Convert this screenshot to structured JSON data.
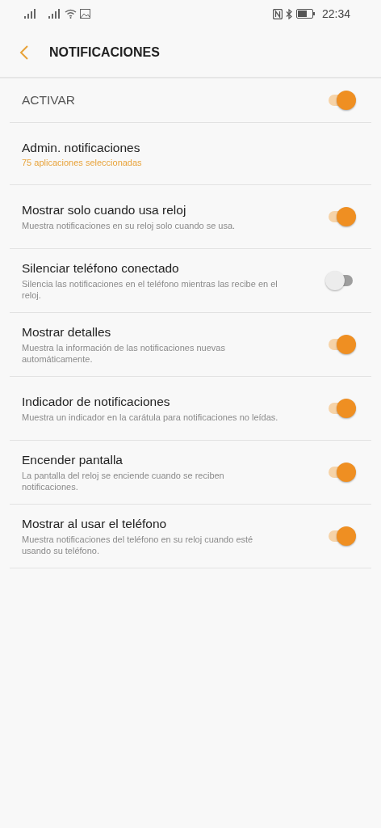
{
  "status_bar": {
    "time": "22:34"
  },
  "header": {
    "title": "NOTIFICACIONES"
  },
  "rows": [
    {
      "kind": "master",
      "title": "ACTIVAR",
      "on": true
    },
    {
      "kind": "link",
      "title": "Admin. notificaciones",
      "subtitle": "75 aplicaciones seleccionadas"
    },
    {
      "kind": "toggle",
      "title": "Mostrar solo cuando usa reloj",
      "description": "Muestra notificaciones en su reloj solo cuando se usa.",
      "on": true
    },
    {
      "kind": "toggle",
      "title": "Silenciar teléfono conectado",
      "description": "Silencia las notificaciones en el teléfono mientras las recibe en el reloj.",
      "on": false
    },
    {
      "kind": "toggle",
      "title": "Mostrar detalles",
      "description": "Muestra la información de las notificaciones nuevas automáticamente.",
      "on": true
    },
    {
      "kind": "toggle",
      "title": "Indicador de notificaciones",
      "description": "Muestra un indicador en la carátula para notificaciones no leídas.",
      "on": true
    },
    {
      "kind": "toggle",
      "title": "Encender pantalla",
      "description": "La pantalla del reloj se enciende cuando se reciben notificaciones.",
      "on": true
    },
    {
      "kind": "toggle",
      "title": "Mostrar al usar el teléfono",
      "description": "Muestra notificaciones del teléfono en su reloj cuando esté usando su teléfono.",
      "on": true
    }
  ]
}
